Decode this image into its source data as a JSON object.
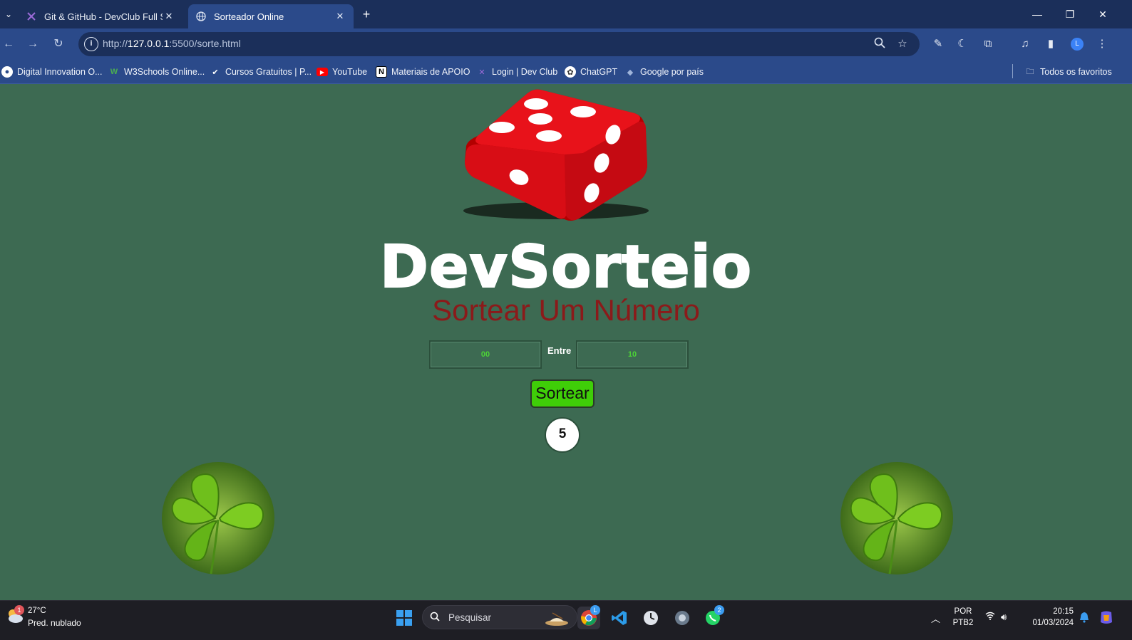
{
  "browser": {
    "tabs": [
      {
        "title": "Git & GitHub - DevClub Full Sta",
        "active": false
      },
      {
        "title": "Sorteador Online",
        "active": true
      }
    ],
    "url_prefix": "http://",
    "url_host": "127.0.0.1",
    "url_path": ":5500/sorte.html",
    "bookmarks": [
      {
        "label": "Digital Innovation O...",
        "icon": "dio-icon"
      },
      {
        "label": "W3Schools Online...",
        "icon": "w3schools-icon"
      },
      {
        "label": "Cursos Gratuitos | P...",
        "icon": "courses-icon"
      },
      {
        "label": "YouTube",
        "icon": "youtube-icon"
      },
      {
        "label": "Materiais de APOIO",
        "icon": "notion-icon"
      },
      {
        "label": "Login | Dev Club",
        "icon": "devclub-icon"
      },
      {
        "label": "ChatGPT",
        "icon": "chatgpt-icon"
      },
      {
        "label": "Google por país",
        "icon": "google-icon"
      }
    ],
    "all_bookmarks": "Todos os favoritos",
    "profile_initial": "L"
  },
  "page": {
    "title": "DevSorteio",
    "subtitle": "Sortear Um Número",
    "min_value": "00",
    "separator": "Entre",
    "max_value": "10",
    "button_label": "Sortear",
    "result": "5",
    "colors": {
      "background": "#3d6a52",
      "subtitle": "#8b1a1a",
      "button": "#3fce08",
      "input_text": "#4cd137"
    }
  },
  "taskbar": {
    "weather_badge": "1",
    "temperature": "27°C",
    "weather": "Pred. nublado",
    "search_placeholder": "Pesquisar",
    "chrome_badge": "L",
    "whatsapp_badge": "2",
    "lang_top": "POR",
    "lang_bottom": "PTB2",
    "time": "20:15",
    "date": "01/03/2024"
  }
}
